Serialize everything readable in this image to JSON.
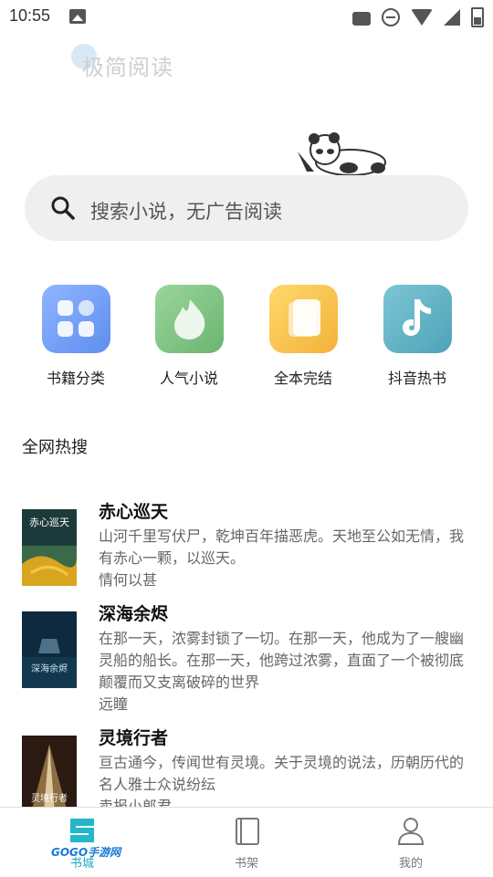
{
  "status_bar": {
    "time": "10:55"
  },
  "brand": {
    "logo_text": "极简阅读"
  },
  "search": {
    "placeholder": "搜索小说，无广告阅读"
  },
  "categories": [
    {
      "label": "书籍分类",
      "icon": "grid-icon",
      "color": "#6f9bf0"
    },
    {
      "label": "人气小说",
      "icon": "flame-icon",
      "color": "#7bc47f"
    },
    {
      "label": "全本完结",
      "icon": "book-stack-icon",
      "color": "#f6c244"
    },
    {
      "label": "抖音热书",
      "icon": "music-note-icon",
      "color": "#62b6c9"
    }
  ],
  "section": {
    "title": "全网热搜"
  },
  "books": [
    {
      "title": "赤心巡天",
      "desc": "山河千里写伏尸，乾坤百年描恶虎。天地至公如无情，我有赤心一颗，以巡天。",
      "author": "情何以甚",
      "cover_text": "赤心巡天"
    },
    {
      "title": "深海余烬",
      "desc": "在那一天，浓雾封锁了一切。在那一天，他成为了一艘幽灵船的船长。在那一天，他跨过浓雾，直面了一个被彻底颠覆而又支离破碎的世界",
      "author": "远瞳",
      "cover_text": "深海余烬"
    },
    {
      "title": "灵境行者",
      "desc": "亘古通今，传闻世有灵境。关于灵境的说法，历朝历代的名人雅士众说纷纭",
      "author": "卖报小郎君",
      "cover_text": "灵境行者"
    }
  ],
  "tabbar": {
    "items": [
      {
        "label": "书城",
        "watermark": "GOGO手游网"
      },
      {
        "label": "书架"
      },
      {
        "label": "我的"
      }
    ]
  }
}
